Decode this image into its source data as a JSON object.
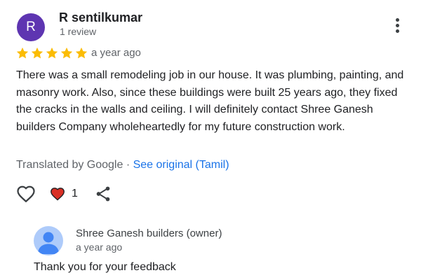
{
  "review": {
    "reviewer": {
      "initial": "R",
      "name": "R sentilkumar",
      "review_count": "1 review",
      "avatar_color": "#5e35b1"
    },
    "rating": 5,
    "date": "a year ago",
    "text": "There was a small remodeling job in our house. It was plumbing, painting, and masonry work. Also, since these buildings were built 25 years ago, they fixed the cracks in the walls and ceiling. I will definitely contact Shree Ganesh builders Company wholeheartedly for my future construction work.",
    "translation": {
      "prefix": "Translated by Google · ",
      "link": "See original (Tamil)"
    },
    "actions": {
      "like_icon": "heart-outline-icon",
      "reaction_icon": "heart-filled-icon",
      "reaction_count": "1",
      "share_icon": "share-icon",
      "more_icon": "more-vert-icon"
    }
  },
  "owner_response": {
    "name": "Shree Ganesh builders (owner)",
    "date": "a year ago",
    "text": "Thank you for your feedback",
    "avatar_icon": "person-icon"
  },
  "colors": {
    "star": "#fbbc04",
    "link": "#1a73e8",
    "heart": "#d93025",
    "owner_avatar_bg": "#aecbfa",
    "owner_avatar_fg": "#4285f4"
  }
}
